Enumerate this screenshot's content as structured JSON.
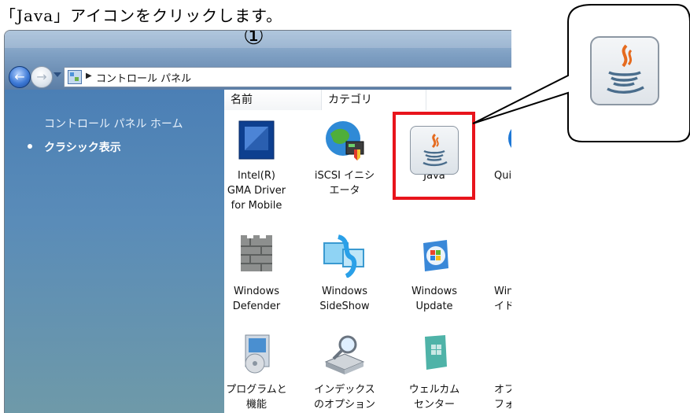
{
  "instruction": "「Java」アイコンをクリックします。",
  "step_marker": "①",
  "address": {
    "breadcrumb": "コントロール パネル"
  },
  "sidebar": {
    "home_link": "コントロール パネル ホーム",
    "classic_view": "クラシック表示"
  },
  "columns": {
    "name": "名前",
    "category": "カテゴリ"
  },
  "items": [
    {
      "label1": "Intel(R)",
      "label2": "GMA Driver",
      "label3": "for Mobile",
      "icon": "intel-gma-icon"
    },
    {
      "label1": "iSCSI イニシ",
      "label2": "エータ",
      "icon": "iscsi-initiator-icon"
    },
    {
      "label1": "Java",
      "icon": "java-icon"
    },
    {
      "label1": "Qui",
      "icon": "quicktime-icon"
    },
    {
      "label1": "Windows",
      "label2": "Defender",
      "icon": "windows-defender-icon"
    },
    {
      "label1": "Windows",
      "label2": "SideShow",
      "icon": "windows-sideshow-icon"
    },
    {
      "label1": "Windows",
      "label2": "Update",
      "icon": "windows-update-icon"
    },
    {
      "label1": "Wind",
      "label2": "イドバ",
      "icon": "windows-sidebar-icon"
    },
    {
      "label1": "プログラムと",
      "label2": "機能",
      "icon": "programs-features-icon"
    },
    {
      "label1": "インデックス",
      "label2": "のオプション",
      "icon": "indexing-options-icon"
    },
    {
      "label1": "ウェルカム",
      "label2": "センター",
      "icon": "welcome-center-icon"
    },
    {
      "label1": "オフ",
      "label2": "フォ",
      "icon": "offline-files-icon"
    }
  ],
  "colors": {
    "highlight": "#e8141c",
    "sidebar": "#4b7fb5"
  }
}
